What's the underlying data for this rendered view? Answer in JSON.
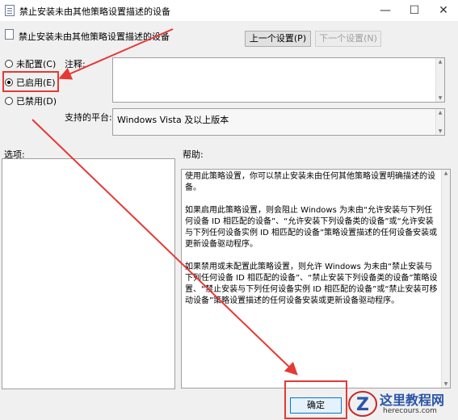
{
  "window": {
    "title": "禁止安装未由其他策略设置描述的设备",
    "minimize_glyph": "—",
    "maximize_glyph": "☐",
    "close_glyph": "✕",
    "icon": "policy-document-icon"
  },
  "header": {
    "policy_name": "禁止安装未由其他策略设置描述的设备",
    "icon": "policy-document-icon",
    "prev_button": "上一个设置(P)",
    "next_button": "下一个设置(N)"
  },
  "state": {
    "options": [
      {
        "label": "未配置(C)",
        "checked": false
      },
      {
        "label": "已启用(E)",
        "checked": true
      },
      {
        "label": "已禁用(D)",
        "checked": false
      }
    ]
  },
  "comment": {
    "label": "注释:",
    "value": ""
  },
  "platform": {
    "label": "支持的平台:",
    "value": "Windows Vista 及以上版本"
  },
  "options_section": {
    "label": "选项:"
  },
  "help_section": {
    "label": "帮助:",
    "paragraphs": [
      "使用此策略设置，你可以禁止安装未由任何其他策略设置明确描述的设备。",
      "如果启用此策略设置，则会阻止 Windows 为未由“允许安装与下列任何设备 ID 相匹配的设备”、“允许安装下列设备类的设备”或“允许安装与下列任何设备实例 ID 相匹配的设备”策略设置描述的任何设备安装或更新设备驱动程序。",
      "如果禁用或未配置此策略设置，则允许 Windows 为未由“禁止安装与下列任何设备 ID 相匹配的设备”、“禁止安装下列设备类的设备”策略设置、“禁止安装与下列任何设备实例 ID 相匹配的设备”或“禁止安装可移动设备”策略设置描述的任何设备安装或更新设备驱动程序。"
    ]
  },
  "footer": {
    "ok_button": "确定"
  },
  "annotations": {
    "color": "#e53935"
  },
  "watermark": {
    "name": "这里教程网",
    "url": "herecours.com",
    "logo": "z-logo-icon",
    "accent": "#2b55a8"
  }
}
